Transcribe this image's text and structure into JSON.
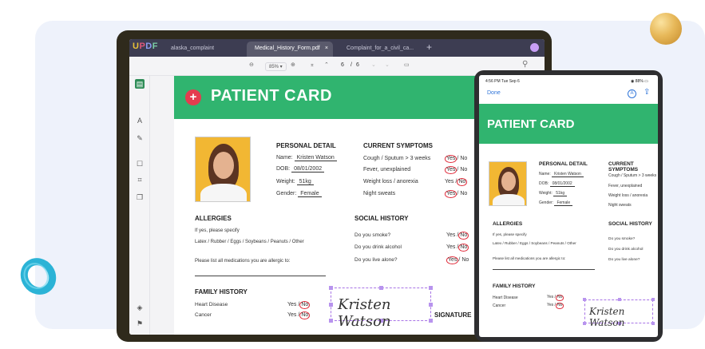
{
  "app": {
    "logo": "UPDF",
    "tabs": [
      {
        "label": "alaska_complaint"
      },
      {
        "label": "Medical_History_Form.pdf",
        "active": true
      },
      {
        "label": "Complaint_for_a_civil_ca..."
      }
    ],
    "tab_close": "×",
    "new_tab": "+"
  },
  "toolbar": {
    "zoom_out_icon": "⊖",
    "zoom_value": "85%",
    "zoom_in_icon": "⊕",
    "page_current": "6",
    "page_sep": "/",
    "page_total": "6",
    "search_icon": "⚲"
  },
  "document": {
    "banner_title": "PATIENT CARD",
    "personal": {
      "heading": "PERSONAL DETAIL",
      "name_label": "Name:",
      "name_value": "Kristen Watson",
      "dob_label": "DOB:",
      "dob_value": "08/01/2002",
      "weight_label": "Weight:",
      "weight_value": "51kg",
      "gender_label": "Gender:",
      "gender_value": "Female"
    },
    "symptoms": {
      "heading": "CURRENT SYMPTOMS",
      "items": [
        {
          "label": "Cough / Sputum > 3 weeks",
          "yes": "Yes",
          "no": "No",
          "circled": "yes"
        },
        {
          "label": "Fever, unexplained",
          "yes": "Yes",
          "no": "No",
          "circled": "yes"
        },
        {
          "label": "Weight loss / anorexia",
          "yes": "Yes",
          "no": "No",
          "circled": "no"
        },
        {
          "label": "Night sweats",
          "yes": "Yes",
          "no": "No",
          "circled": "yes"
        }
      ]
    },
    "allergies": {
      "heading": "ALLERGIES",
      "line1": "If yes, please specify",
      "line2": "Latex / Rubber / Eggs / Soybeans / Peanuts / Other",
      "line3": "Please list all medications you are allergic to:"
    },
    "social": {
      "heading": "SOCIAL HISTORY",
      "items": [
        {
          "label": "Do you smoke?",
          "yes": "Yes",
          "no": "No",
          "circled": "no"
        },
        {
          "label": "Do you drink alcohol",
          "yes": "Yes",
          "no": "No",
          "circled": "no"
        },
        {
          "label": "Do you live alone?",
          "yes": "Yes",
          "no": "No",
          "circled": "yes"
        }
      ]
    },
    "family": {
      "heading": "FAMILY HISTORY",
      "items": [
        {
          "label": "Heart Disease",
          "yes": "Yes",
          "no": "No",
          "circled": "no"
        },
        {
          "label": "Cancer",
          "yes": "Yes",
          "no": "No",
          "circled": "no"
        }
      ]
    },
    "signature_text": "Kristen Watson",
    "signature_label": "SIGNATURE"
  },
  "tablet": {
    "time": "4:56 PM  Tue Sep 6",
    "battery": "88%",
    "done": "Done"
  },
  "colors": {
    "accent_green": "#30b46f",
    "circle_red": "#e02b3a",
    "signature_purple": "#a874e6"
  }
}
